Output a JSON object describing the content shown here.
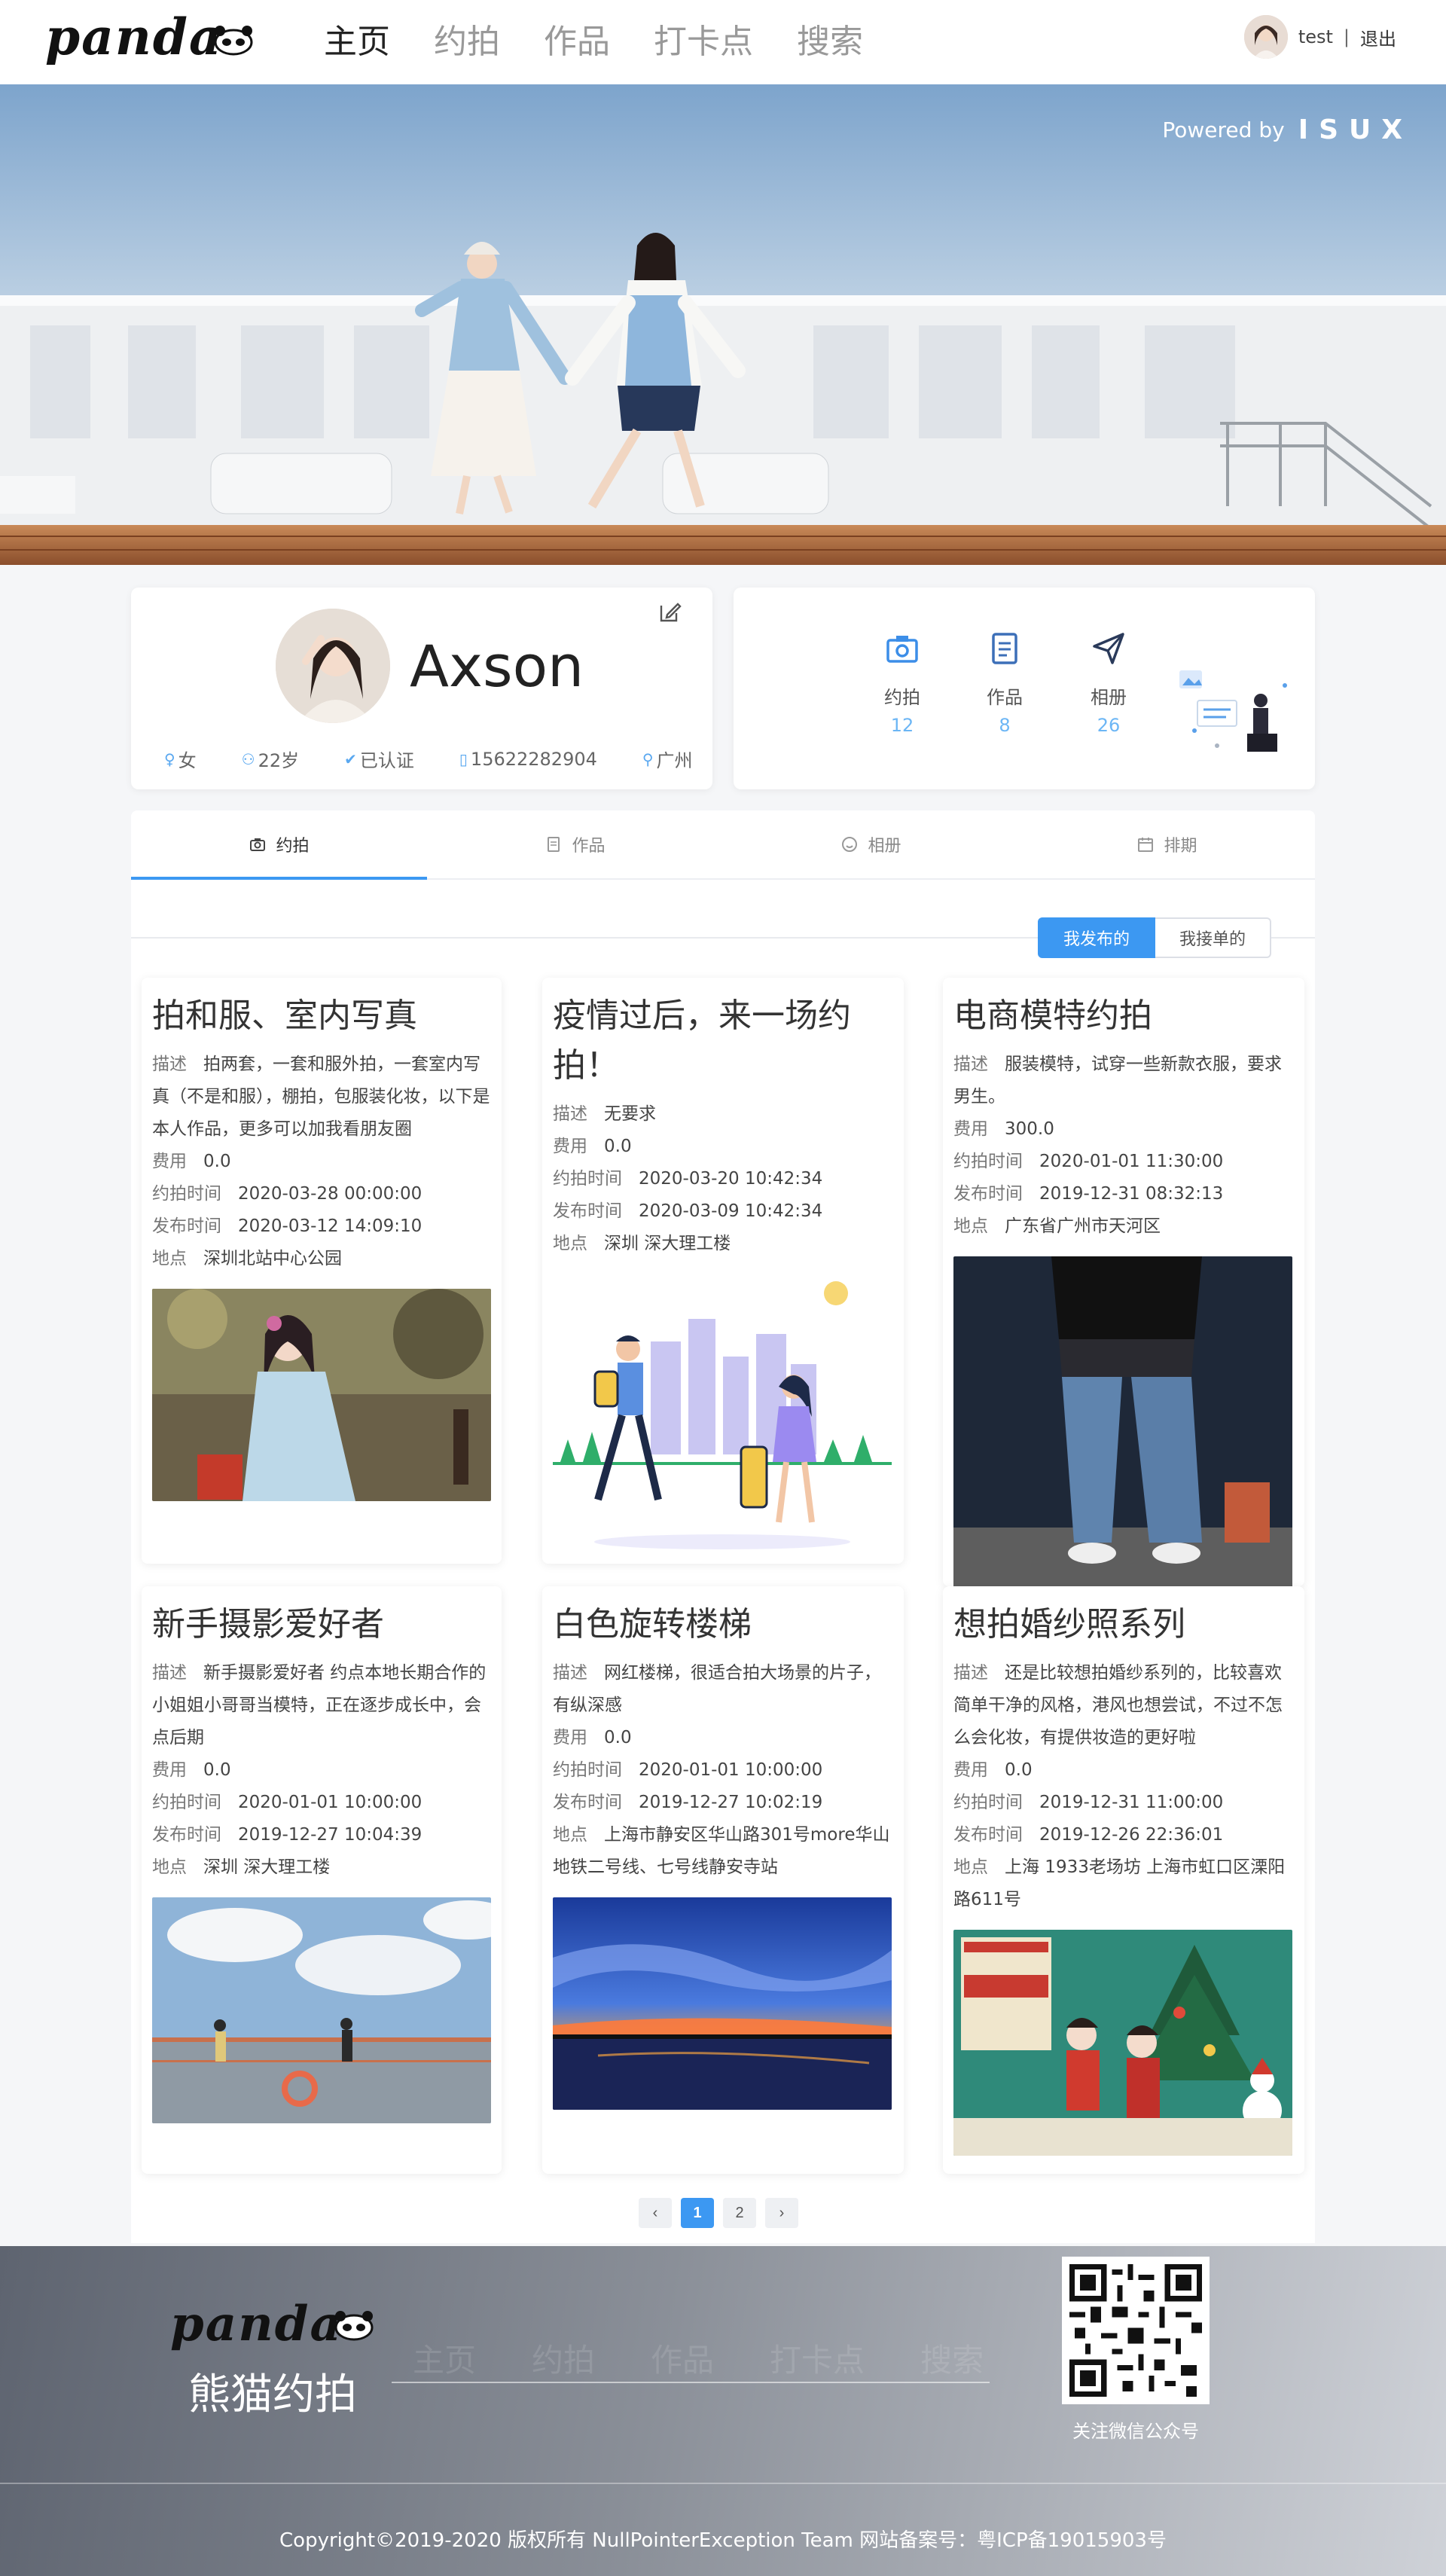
{
  "header": {
    "logo_text": "panda",
    "nav": [
      "主页",
      "约拍",
      "作品",
      "打卡点",
      "搜索"
    ],
    "active_nav": 0,
    "user": {
      "name": "test",
      "separator": "|",
      "logout": "退出"
    }
  },
  "banner": {
    "powered_label": "Powered by",
    "powered_brand": "ISUX"
  },
  "profile": {
    "name": "Axson",
    "gender": "女",
    "age": "22岁",
    "verified": "已认证",
    "phone": "15622282904",
    "city": "广州"
  },
  "stats": [
    {
      "label": "约拍",
      "count": "12",
      "icon": "camera-icon"
    },
    {
      "label": "作品",
      "count": "8",
      "icon": "document-icon"
    },
    {
      "label": "相册",
      "count": "26",
      "icon": "send-icon"
    }
  ],
  "tabs": [
    {
      "label": "约拍",
      "icon": "camera-icon"
    },
    {
      "label": "作品",
      "icon": "document-icon"
    },
    {
      "label": "相册",
      "icon": "smile-icon"
    },
    {
      "label": "排期",
      "icon": "calendar-icon"
    }
  ],
  "filter": {
    "published": "我发布的",
    "accepted": "我接单的"
  },
  "labels": {
    "desc": "描述",
    "fee": "费用",
    "shoot_time": "约拍时间",
    "publish_time": "发布时间",
    "place": "地点"
  },
  "posts": [
    {
      "title": "拍和服、室内写真",
      "desc": "拍两套，一套和服外拍，一套室内写真（不是和服），棚拍，包服装化妆，以下是本人作品，更多可以加我看朋友圈",
      "fee": "0.0",
      "shoot_time": "2020-03-28 00:00:00",
      "publish_time": "2020-03-12 14:09:10",
      "place": "深圳北站中心公园"
    },
    {
      "title": "疫情过后，来一场约拍！",
      "desc": "无要求",
      "fee": "0.0",
      "shoot_time": "2020-03-20 10:42:34",
      "publish_time": "2020-03-09 10:42:34",
      "place": "深圳 深大理工楼"
    },
    {
      "title": "电商模特约拍",
      "desc": "服装模特，试穿一些新款衣服，要求男生。",
      "fee": "300.0",
      "shoot_time": "2020-01-01 11:30:00",
      "publish_time": "2019-12-31 08:32:13",
      "place": "广东省广州市天河区"
    },
    {
      "title": "新手摄影爱好者",
      "desc": "新手摄影爱好者 约点本地长期合作的小姐姐小哥哥当模特，正在逐步成长中，会点后期",
      "fee": "0.0",
      "shoot_time": "2020-01-01 10:00:00",
      "publish_time": "2019-12-27 10:04:39",
      "place": "深圳 深大理工楼"
    },
    {
      "title": "白色旋转楼梯",
      "desc": "网红楼梯，很适合拍大场景的片子，有纵深感",
      "fee": "0.0",
      "shoot_time": "2020-01-01 10:00:00",
      "publish_time": "2019-12-27 10:02:19",
      "place": "上海市静安区华山路301号more华山 地铁二号线、七号线静安寺站"
    },
    {
      "title": "想拍婚纱照系列",
      "desc": "还是比较想拍婚纱系列的，比较喜欢简单干净的风格，港风也想尝试，不过不怎么会化妆，有提供妆造的更好啦",
      "fee": "0.0",
      "shoot_time": "2019-12-31 11:00:00",
      "publish_time": "2019-12-26 22:36:01",
      "place": "上海 1933老场坊 上海市虹口区溧阳路611号"
    }
  ],
  "pager": {
    "prev": "‹",
    "pages": [
      "1",
      "2"
    ],
    "current": "1",
    "next": "›"
  },
  "footer": {
    "logo_text": "panda",
    "brand": "熊猫约拍",
    "nav": [
      "主页",
      "约拍",
      "作品",
      "打卡点",
      "搜索"
    ],
    "qr_label": "关注微信公众号",
    "copyright": "Copyright©2019-2020 版权所有 NullPointerException Team 网站备案号：粤ICP备19015903号"
  },
  "colors": {
    "accent": "#3c98f2",
    "count": "#6cb6f5"
  }
}
